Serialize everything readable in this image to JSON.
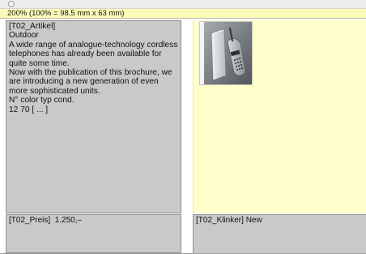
{
  "zoom": {
    "label": "200% (100% = 98,5 mm x 63 mm)"
  },
  "text_frame": {
    "lines": [
      "[T02_Artikel]",
      "Outdoor",
      "A wide range of analogue-technology cordless",
      "telephones has already been available for",
      "quite some time.",
      "Now with the publication of this brochure, we",
      "are introducing a new generation of even",
      "more sophisticated units.",
      "N° color typ cond.",
      "12 70 [ ... ]"
    ]
  },
  "price_frame": {
    "label": "[T02_Preis]",
    "value": "1.250,–"
  },
  "klinker_frame": {
    "label": "[T02_Klinker]",
    "value": "New"
  },
  "image": {
    "icon": "cordless-phone-image"
  },
  "colors": {
    "zoom_bar": "#fbfbb9",
    "frame_gray": "#c9c9c9",
    "image_panel": "#ffffcc"
  }
}
